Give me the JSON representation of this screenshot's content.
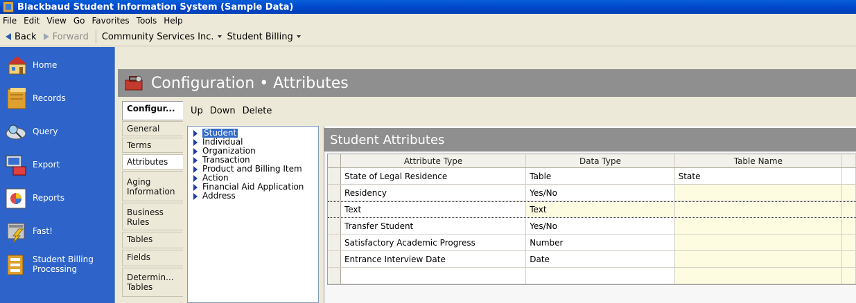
{
  "window": {
    "title": "Blackbaud Student Information System (Sample Data)"
  },
  "menu": [
    "File",
    "Edit",
    "View",
    "Go",
    "Favorites",
    "Tools",
    "Help"
  ],
  "nav": {
    "back": "Back",
    "forward": "Forward",
    "crumb1": "Community Services Inc.",
    "crumb2": "Student Billing"
  },
  "sidebar": {
    "items": [
      {
        "label": "Home",
        "icon": "home-icon"
      },
      {
        "label": "Records",
        "icon": "records-icon"
      },
      {
        "label": "Query",
        "icon": "query-icon"
      },
      {
        "label": "Export",
        "icon": "export-icon"
      },
      {
        "label": "Reports",
        "icon": "reports-icon"
      },
      {
        "label": "Fast!",
        "icon": "fast-icon"
      },
      {
        "label": "Student Billing Processing",
        "icon": "billing-icon"
      }
    ]
  },
  "page": {
    "title": "Configuration • Attributes"
  },
  "tabs": [
    "Configur...",
    "General",
    "Terms",
    "Attributes",
    "Aging Information",
    "Business Rules",
    "Tables",
    "Fields",
    "Determin... Tables"
  ],
  "toolbar": {
    "up": "Up",
    "down": "Down",
    "delete": "Delete"
  },
  "tree": [
    "Student",
    "Individual",
    "Organization",
    "Transaction",
    "Product and Billing Item",
    "Action",
    "Financial Aid Application",
    "Address"
  ],
  "panel": {
    "title": "Student Attributes"
  },
  "grid": {
    "columns": [
      "Attribute Type",
      "Data Type",
      "Table Name"
    ],
    "rows": [
      [
        "State of Legal Residence",
        "Table",
        "State"
      ],
      [
        "Residency",
        "Yes/No",
        ""
      ],
      [
        "Text",
        "Text",
        ""
      ],
      [
        "Transfer Student",
        "Yes/No",
        ""
      ],
      [
        "Satisfactory Academic Progress",
        "Number",
        ""
      ],
      [
        "Entrance Interview Date",
        "Date",
        ""
      ],
      [
        "",
        "",
        ""
      ]
    ]
  },
  "colors": {
    "sidebar": "#2e64c9",
    "header": "#8f8f8f",
    "titlebar": "#0048cc",
    "selection": "#316ac5"
  }
}
